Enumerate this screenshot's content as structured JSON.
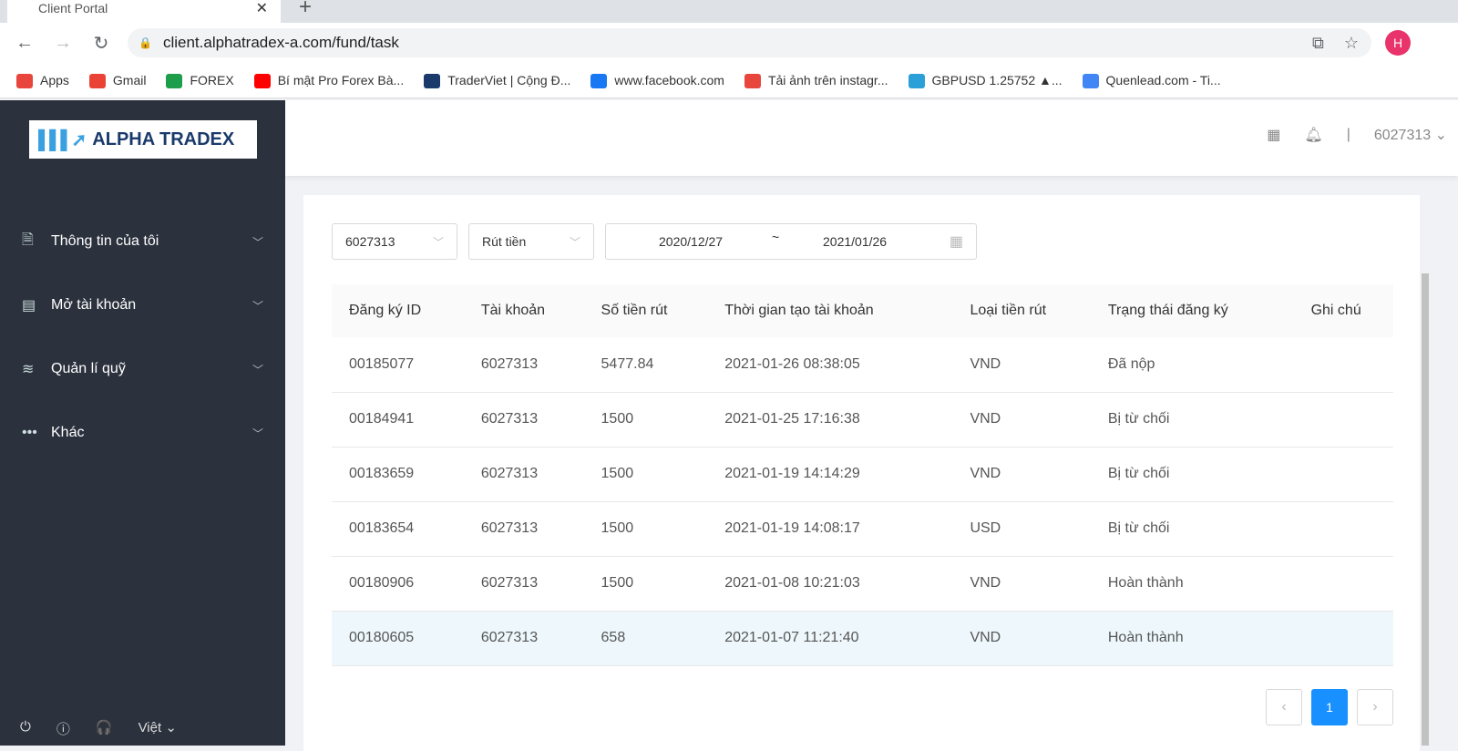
{
  "browser": {
    "tab_title": "Client Portal",
    "url": "client.alphatradex-a.com/fund/task",
    "avatar": "H",
    "bookmarks": [
      {
        "label": "Apps",
        "color": "#e8453c"
      },
      {
        "label": "Gmail",
        "color": "#ea4335"
      },
      {
        "label": "FOREX",
        "color": "#1e9e4a"
      },
      {
        "label": "Bí mật Pro Forex Bà...",
        "color": "#ff0000"
      },
      {
        "label": "TraderViet | Cộng Đ...",
        "color": "#1a3a6b"
      },
      {
        "label": "www.facebook.com",
        "color": "#1877f2"
      },
      {
        "label": "Tải ảnh trên instagr...",
        "color": "#e8453c"
      },
      {
        "label": "GBPUSD 1.25752 ▲...",
        "color": "#2a9fd8"
      },
      {
        "label": "Quenlead.com - Ti...",
        "color": "#4285f4"
      }
    ]
  },
  "sidebar": {
    "logo": "ALPHA TRADEX",
    "items": [
      {
        "label": "Thông tin của tôi",
        "icon": "document-icon"
      },
      {
        "label": "Mở tài khoản",
        "icon": "card-icon"
      },
      {
        "label": "Quản lí quỹ",
        "icon": "database-icon"
      },
      {
        "label": "Khác",
        "icon": "more-icon"
      }
    ],
    "language": "Việt"
  },
  "header": {
    "account": "6027313"
  },
  "filters": {
    "account": "6027313",
    "type": "Rút tiền",
    "date_from": "2020/12/27",
    "date_sep": "~",
    "date_to": "2021/01/26"
  },
  "table": {
    "headers": [
      "Đăng ký ID",
      "Tài khoản",
      "Số tiền rút",
      "Thời gian tạo tài khoản",
      "Loại tiền rút",
      "Trạng thái đăng ký",
      "Ghi chú"
    ],
    "rows": [
      [
        "00185077",
        "6027313",
        "5477.84",
        "2021-01-26 08:38:05",
        "VND",
        "Đã nộp",
        ""
      ],
      [
        "00184941",
        "6027313",
        "1500",
        "2021-01-25 17:16:38",
        "VND",
        "Bị từ chối",
        ""
      ],
      [
        "00183659",
        "6027313",
        "1500",
        "2021-01-19 14:14:29",
        "VND",
        "Bị từ chối",
        ""
      ],
      [
        "00183654",
        "6027313",
        "1500",
        "2021-01-19 14:08:17",
        "USD",
        "Bị từ chối",
        ""
      ],
      [
        "00180906",
        "6027313",
        "1500",
        "2021-01-08 10:21:03",
        "VND",
        "Hoàn thành",
        ""
      ],
      [
        "00180605",
        "6027313",
        "658",
        "2021-01-07 11:21:40",
        "VND",
        "Hoàn thành",
        ""
      ]
    ]
  },
  "pagination": {
    "current": "1"
  }
}
